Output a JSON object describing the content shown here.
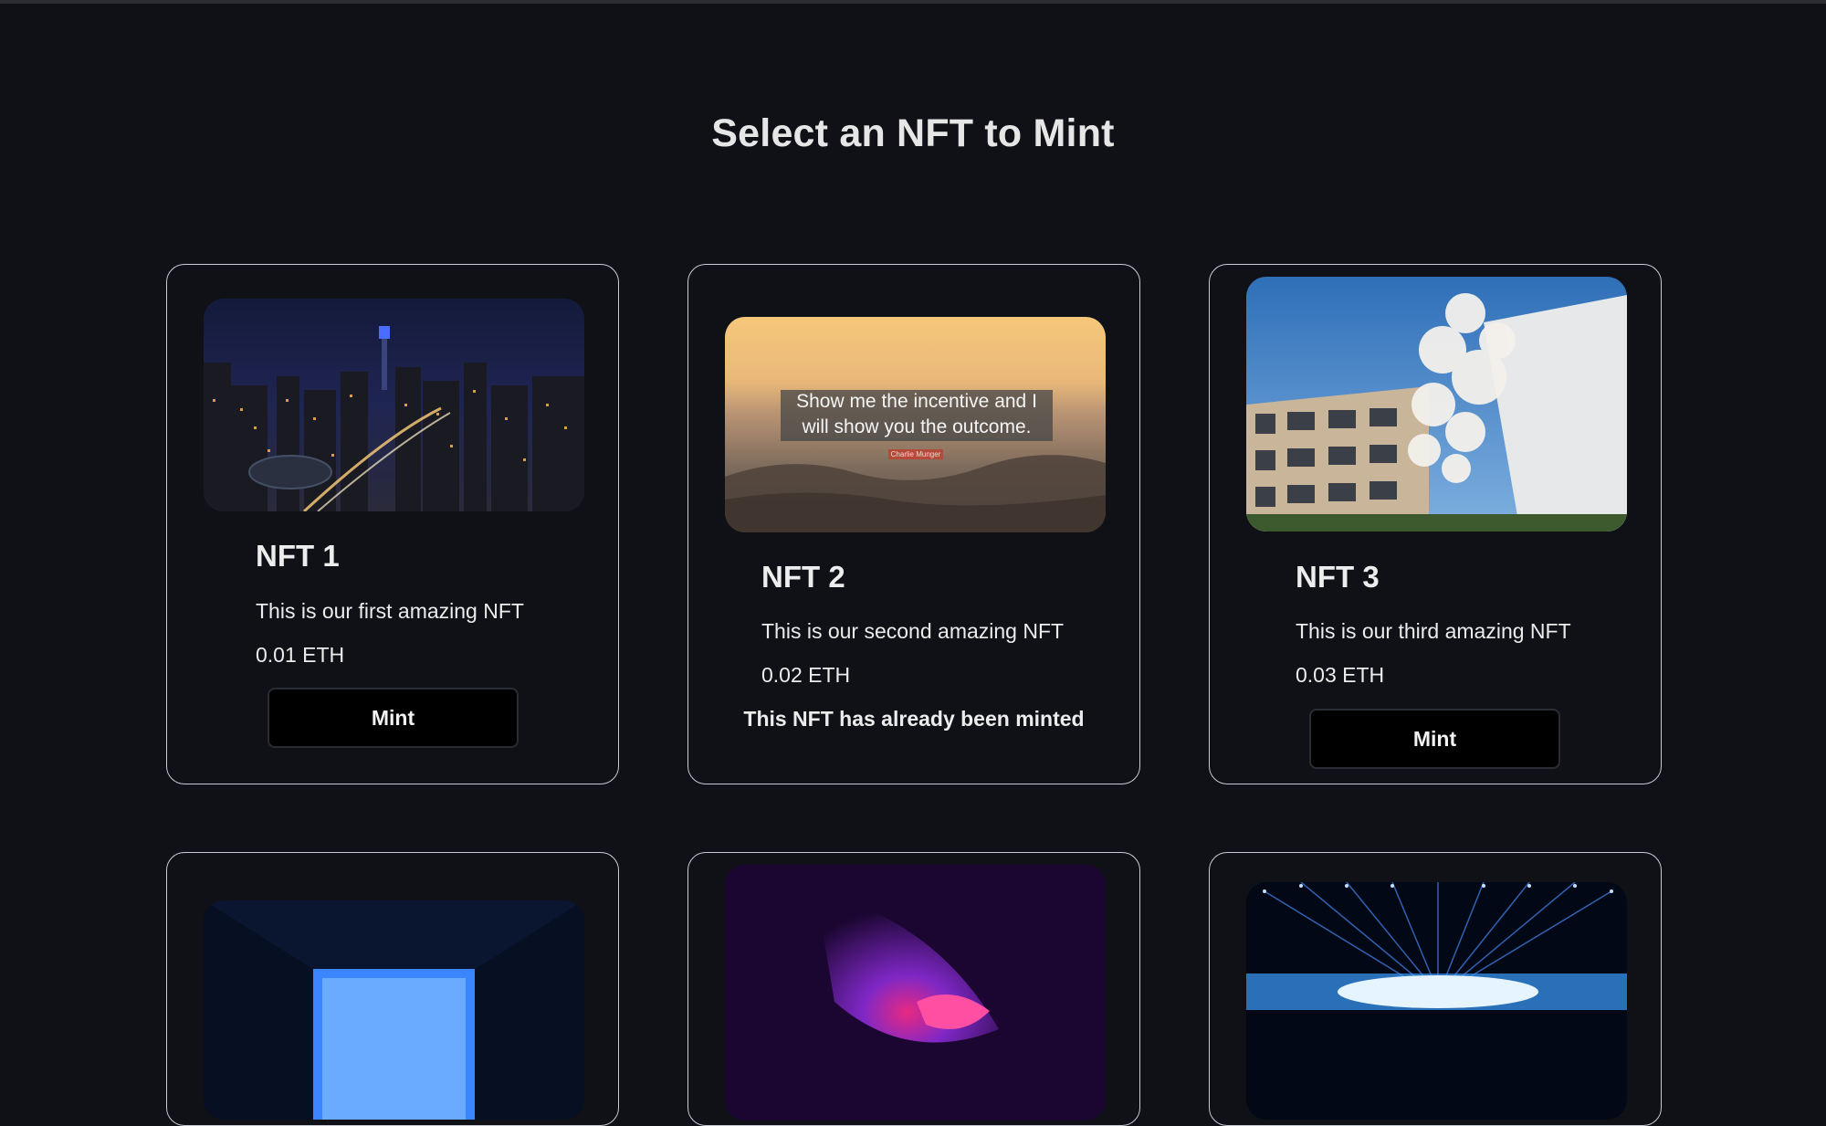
{
  "page": {
    "title": "Select an NFT to Mint"
  },
  "nfts": [
    {
      "name": "NFT 1",
      "description": "This is our first amazing NFT",
      "price": "0.01 ETH",
      "mint_label": "Mint",
      "image": "night-city-skyline"
    },
    {
      "name": "NFT 2",
      "description": "This is our second amazing NFT",
      "price": "0.02 ETH",
      "status": "This NFT has already been minted",
      "image": "quote-sunset-ocean",
      "image_text": {
        "quote_line1": "Show me the incentive and I",
        "quote_line2": "will show you the outcome.",
        "author": "Charlie Munger"
      }
    },
    {
      "name": "NFT 3",
      "description": "This is our third amazing NFT",
      "price": "0.03 ETH",
      "mint_label": "Mint",
      "image": "building-blossom-tree"
    },
    {
      "image": "blue-light-tunnel"
    },
    {
      "image": "purple-pink-abstract"
    },
    {
      "image": "fiber-optic-lights"
    }
  ],
  "colors": {
    "background": "#0f1117",
    "card_border": "#c9ccd3",
    "button_bg": "#000000",
    "text": "#e8e8e8"
  }
}
